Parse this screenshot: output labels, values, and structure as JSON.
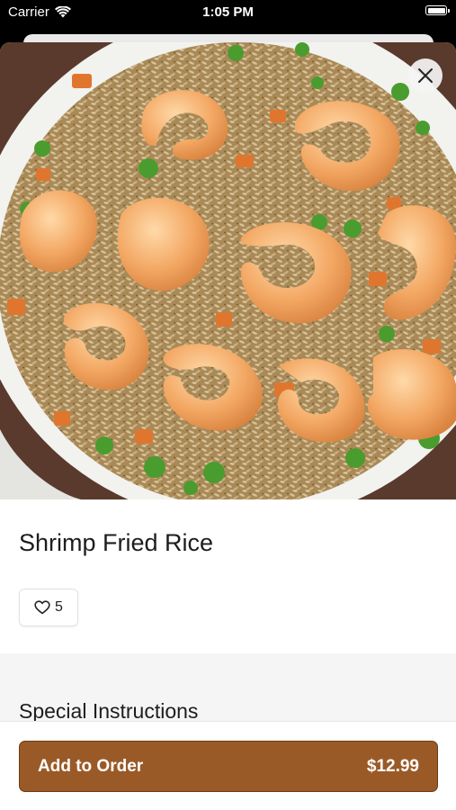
{
  "status_bar": {
    "carrier": "Carrier",
    "time": "1:05 PM"
  },
  "item": {
    "name": "Shrimp Fried Rice",
    "likes": "5",
    "price": "$12.99"
  },
  "sections": {
    "special_instructions": "Special Instructions"
  },
  "actions": {
    "add_to_order": "Add to Order"
  },
  "colors": {
    "accent": "#9a5a27",
    "accent_border": "#6b3b14"
  },
  "icons": {
    "close": "close-icon",
    "like": "heart-icon",
    "wifi": "wifi-icon",
    "battery": "battery-icon"
  }
}
